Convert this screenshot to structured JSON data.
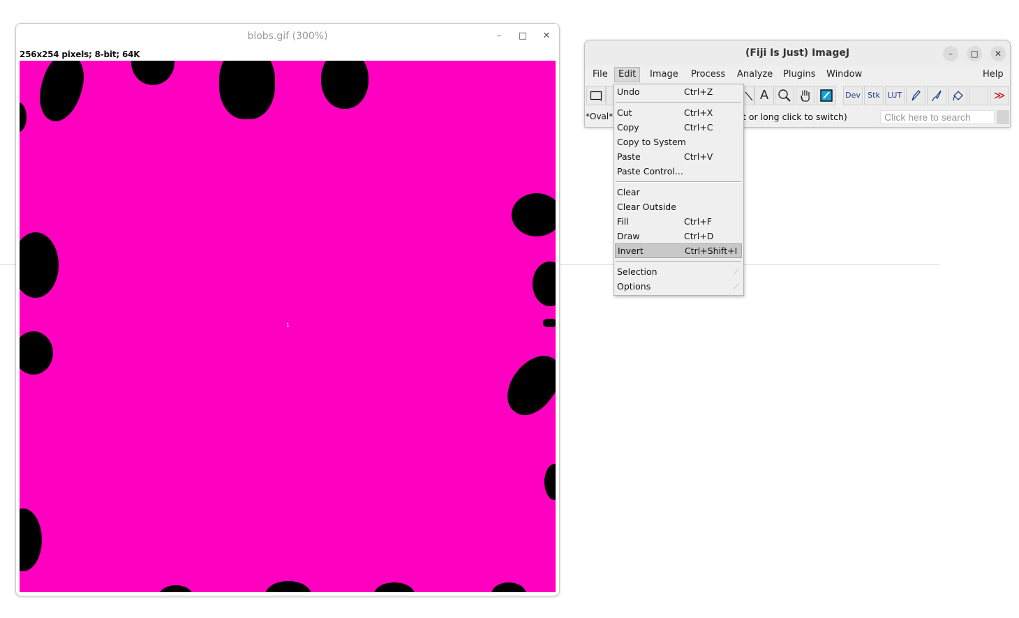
{
  "image_window": {
    "title": "blobs.gif (300%)",
    "info": "256x254 pixels; 8-bit; 64K",
    "minimize": "–",
    "maximize": "□",
    "close": "✕",
    "canvas_mark": "1"
  },
  "colors": {
    "canvas_background": "#ff00c0",
    "blob": "#000000",
    "window_bg": "#efefef",
    "highlight": "#c8c8c8"
  },
  "imagej": {
    "title": "(Fiji Is Just) ImageJ",
    "minimize": "–",
    "maximize": "□",
    "close": "✕",
    "menu": [
      "File",
      "Edit",
      "Image",
      "Process",
      "Analyze",
      "Plugins",
      "Window",
      "Help"
    ],
    "active_menu": "Edit",
    "toolbar": {
      "rectangle_tool": "rectangle-icon",
      "text_tool": "A",
      "dev": "Dev",
      "stk": "Stk",
      "lut": "LUT",
      "more": "≫"
    },
    "status_left": "*Oval*",
    "status_right": "t or long click to switch)",
    "search_placeholder": "Click here to search"
  },
  "edit_menu": {
    "items": [
      {
        "label": "Undo",
        "shortcut": "Ctrl+Z"
      },
      {
        "label": "Cut",
        "shortcut": "Ctrl+X"
      },
      {
        "label": "Copy",
        "shortcut": "Ctrl+C"
      },
      {
        "label": "Copy to System",
        "shortcut": ""
      },
      {
        "label": "Paste",
        "shortcut": "Ctrl+V"
      },
      {
        "label": "Paste Control...",
        "shortcut": ""
      },
      {
        "label": "Clear",
        "shortcut": ""
      },
      {
        "label": "Clear Outside",
        "shortcut": ""
      },
      {
        "label": "Fill",
        "shortcut": "Ctrl+F"
      },
      {
        "label": "Draw",
        "shortcut": "Ctrl+D"
      },
      {
        "label": "Invert",
        "shortcut": "Ctrl+Shift+I"
      },
      {
        "label": "Selection",
        "shortcut": ""
      },
      {
        "label": "Options",
        "shortcut": ""
      }
    ],
    "highlighted": "Invert"
  }
}
